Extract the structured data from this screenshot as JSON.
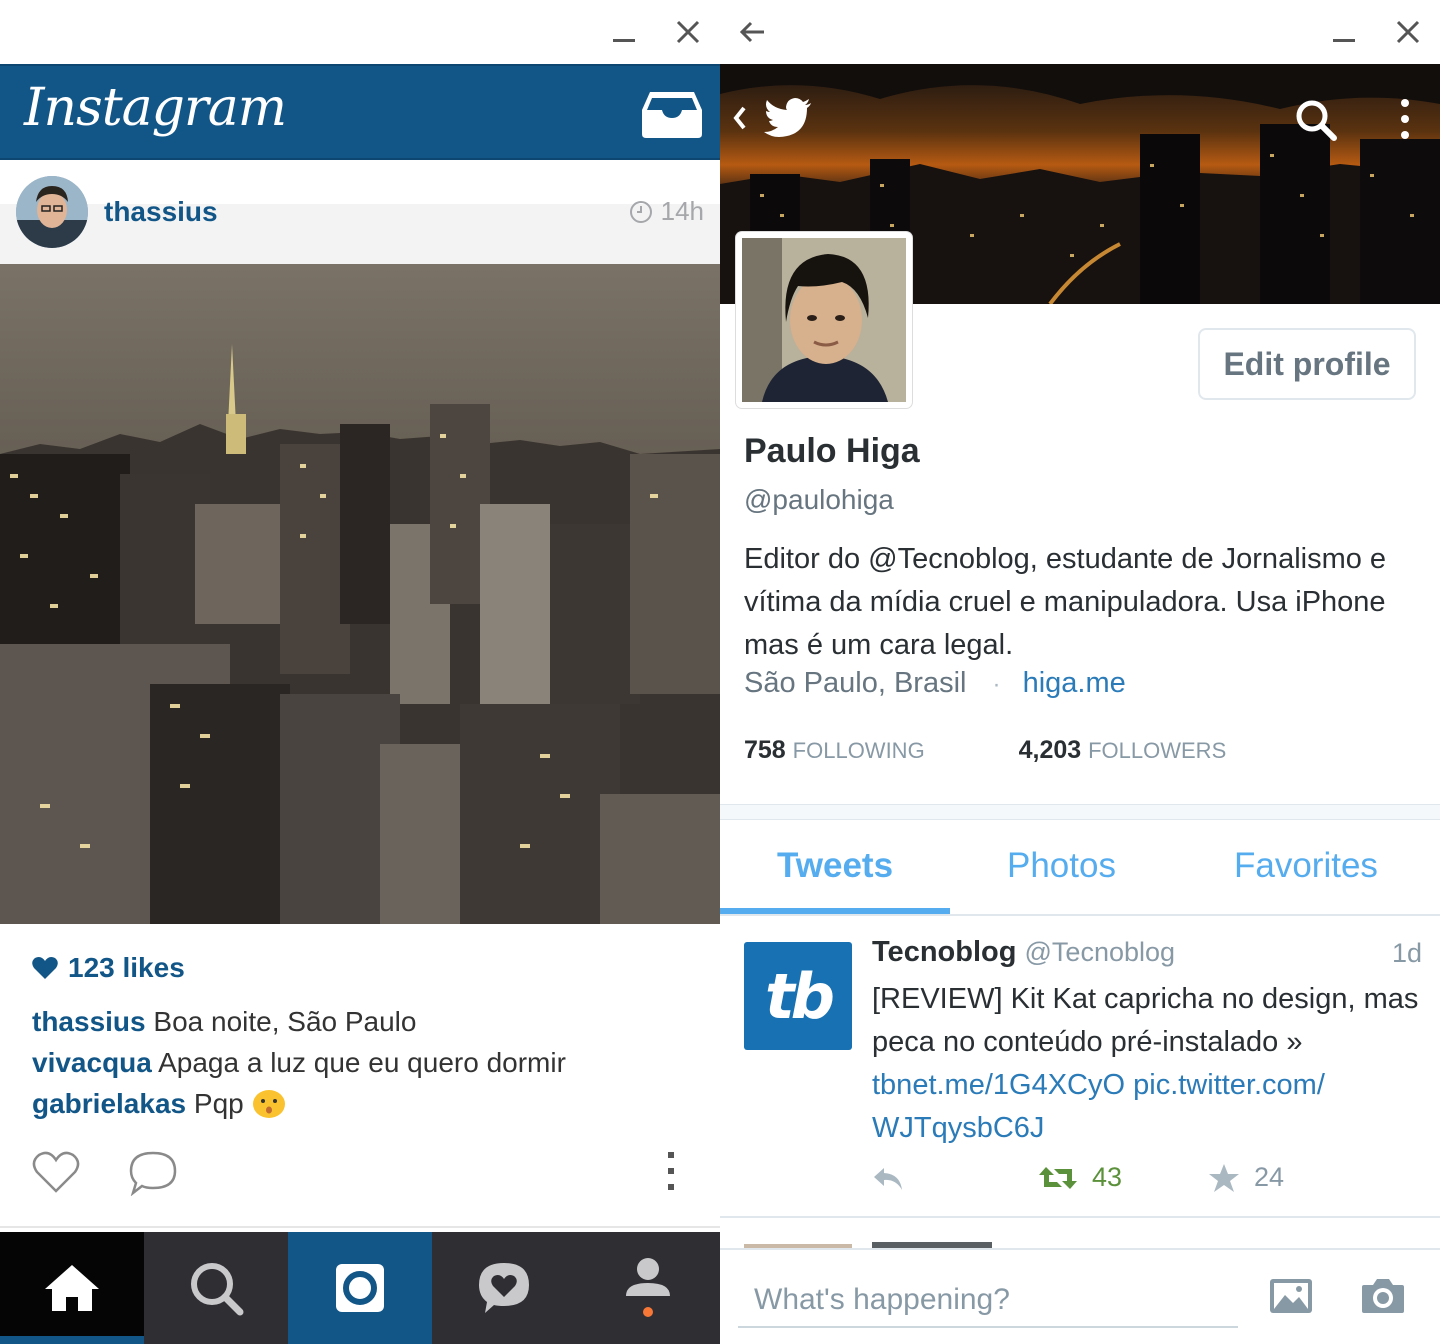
{
  "instagram": {
    "logo": "Instagram",
    "post": {
      "username": "thassius",
      "time": "14h",
      "likes": "123 likes",
      "comments": [
        {
          "user": "thassius",
          "text": "Boa noite, São Paulo"
        },
        {
          "user": "vivacqua",
          "text": "Apaga a luz que eu quero dormir"
        },
        {
          "user": "gabrielakas",
          "text": "Pqp"
        }
      ]
    },
    "nav": [
      "home-icon",
      "search-icon",
      "camera-icon",
      "activity-heart-icon",
      "profile-icon"
    ],
    "colors": {
      "brand": "#125688",
      "nav_bg": "#2e2e33",
      "notification_dot": "#f77737"
    }
  },
  "twitter": {
    "profile": {
      "name": "Paulo Higa",
      "handle": "@paulohiga",
      "bio": "Editor do @Tecnoblog, estudante de Jornalismo e vítima da mídia cruel e manipuladora. Usa iPhone mas é um cara legal.",
      "location": "São Paulo, Brasil",
      "separator": "·",
      "website": "higa.me",
      "edit_label": "Edit profile",
      "following_count": "758",
      "following_label": "FOLLOWING",
      "followers_count": "4,203",
      "followers_label": "FOLLOWERS"
    },
    "tabs": [
      "Tweets",
      "Photos",
      "Favorites"
    ],
    "tweet": {
      "name": "Tecnoblog",
      "handle": "@Tecnoblog",
      "time": "1d",
      "logo_text": "tb",
      "text": "[REVIEW] Kit Kat capricha no design, mas peca no conteúdo pré-instalado »",
      "link1": "tbnet.me/1G4XCyO",
      "link2": "pic.twitter.com/",
      "link3": "WJTqysbC6J",
      "retweets": "43",
      "favorites": "24"
    },
    "compose_placeholder": "What's happening?",
    "colors": {
      "accent": "#55acee",
      "link": "#2b7bb9",
      "retweet": "#5c913b"
    }
  }
}
